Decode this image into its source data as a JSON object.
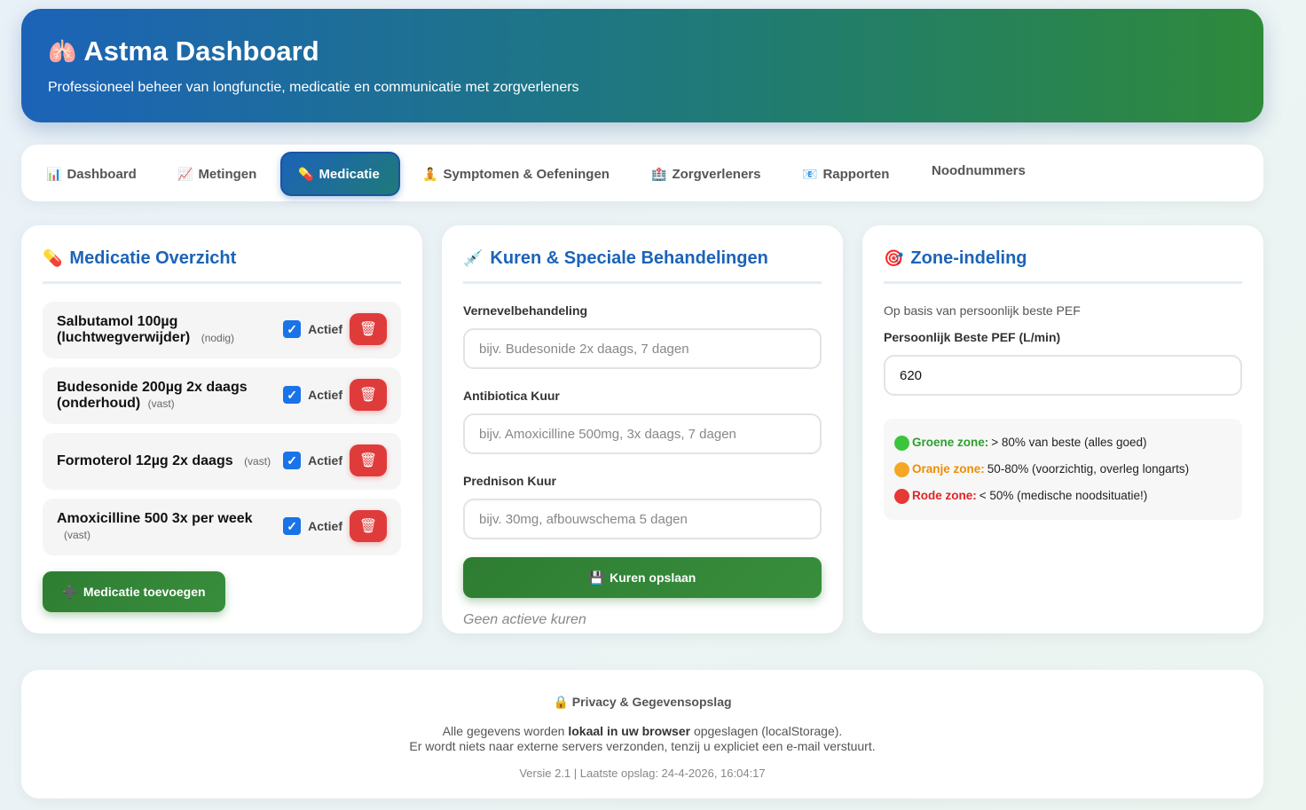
{
  "header": {
    "icon": "lungs-icon",
    "title": "Astma Dashboard",
    "subtitle": "Professioneel beheer van longfunctie, medicatie en communicatie met zorgverleners"
  },
  "nav": {
    "tabs": [
      {
        "icon": "📊",
        "label": "Dashboard"
      },
      {
        "icon": "📈",
        "label": "Metingen"
      },
      {
        "icon": "💊",
        "label": "Medicatie",
        "active": true
      },
      {
        "icon": "🧘",
        "label": "Symptomen & Oefeningen"
      },
      {
        "icon": "🏥",
        "label": "Zorgverleners"
      },
      {
        "icon": "📧",
        "label": "Rapporten"
      },
      {
        "icon": "",
        "label": "Noodnummers"
      }
    ]
  },
  "medication": {
    "title": "Medicatie Overzicht",
    "items": [
      {
        "name": "Salbutamol 100µg (luchtwegverwijder)",
        "type": "(nodig)",
        "status": "Actief",
        "active": true
      },
      {
        "name": "Budesonide 200µg 2x daags (onderhoud)",
        "type": "(vast)",
        "status": "Actief",
        "active": true
      },
      {
        "name": "Formoterol 12µg 2x daags",
        "type": "(vast)",
        "status": "Actief",
        "active": true
      },
      {
        "name": "Amoxicilline 500 3x per week",
        "type": "(vast)",
        "status": "Actief",
        "active": true
      }
    ],
    "add_button": "Medicatie toevoegen"
  },
  "courses": {
    "title": "Kuren & Speciale Behandelingen",
    "nebulizer_label": "Vernevelbehandeling",
    "nebulizer_placeholder": "bijv. Budesonide 2x daags, 7 dagen",
    "antibiotics_label": "Antibiotica Kuur",
    "antibiotics_placeholder": "bijv. Amoxicilline 500mg, 3x daags, 7 dagen",
    "prednison_label": "Prednison Kuur",
    "prednison_placeholder": "bijv. 30mg, afbouwschema 5 dagen",
    "save_button": "Kuren opslaan",
    "empty_text": "Geen actieve kuren"
  },
  "zones": {
    "title": "Zone-indeling",
    "subtitle": "Op basis van persoonlijk beste PEF",
    "pef_label": "Persoonlijk Beste PEF (L/min)",
    "pef_value": "620",
    "list": [
      {
        "name": "Groene zone:",
        "desc": "> 80% van beste (alles goed)",
        "color": "#2e9e2e",
        "dot": "#3cc43c"
      },
      {
        "name": "Oranje zone:",
        "desc": "50-80% (voorzichtig, overleg longarts)",
        "color": "#f08c00",
        "dot": "#f5a623"
      },
      {
        "name": "Rode zone:",
        "desc": "< 50% (medische noodsituatie!)",
        "color": "#e02424",
        "dot": "#e53935"
      }
    ]
  },
  "footer": {
    "title": "Privacy & Gegevensopslag",
    "line1_pre": "Alle gegevens worden",
    "line1_bold": "lokaal in uw browser",
    "line1_post": "opgeslagen (localStorage).",
    "line2": "Er wordt niets naar externe servers verzonden, tenzij u expliciet een e-mail verstuurt.",
    "version": "Versie 2.1 | Laatste opslag: 24-4-2026, 16:04:17"
  }
}
